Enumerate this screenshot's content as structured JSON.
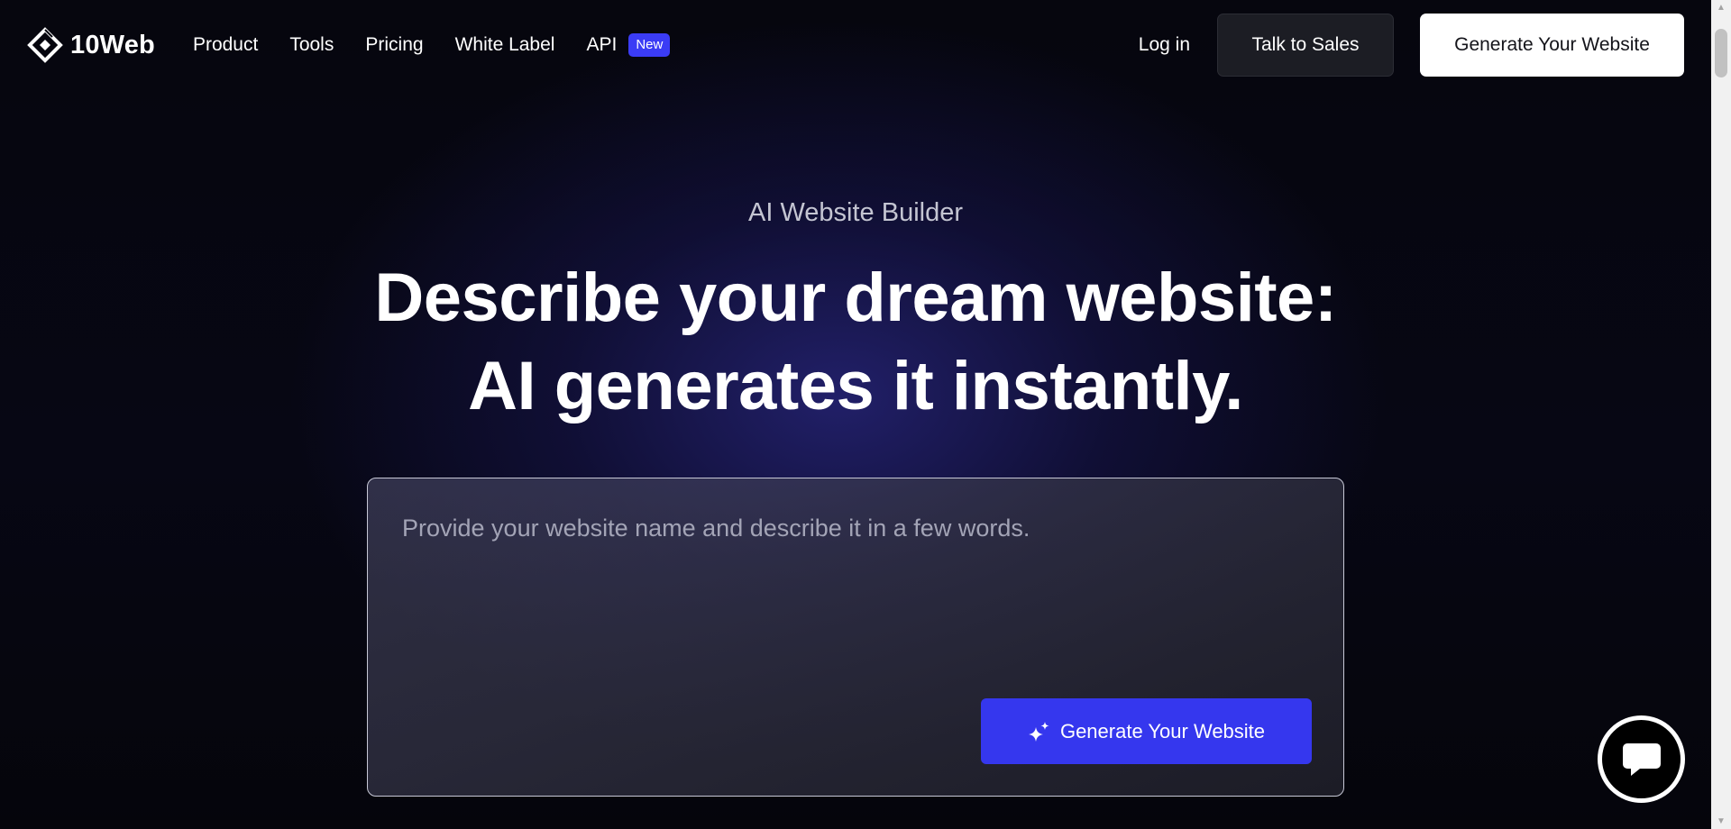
{
  "brand": {
    "name": "10Web"
  },
  "nav": {
    "links": [
      "Product",
      "Tools",
      "Pricing",
      "White Label"
    ],
    "api_label": "API",
    "api_badge": "New",
    "login": "Log in",
    "sales_button": "Talk to Sales",
    "generate_button": "Generate Your Website"
  },
  "hero": {
    "eyebrow": "AI Website Builder",
    "headline_line1": "Describe your dream website:",
    "headline_line2": "AI generates it instantly.",
    "prompt_placeholder": "Provide your website name and describe it in a few words.",
    "prompt_value": "",
    "generate_button": "Generate Your Website"
  },
  "icons": {
    "logo": "diamond-logo-icon",
    "generate": "sparkle-icon",
    "chat": "chat-bubble-icon"
  },
  "colors": {
    "accent": "#3537ee",
    "badge": "#3b3cf5",
    "nav_dark_button": "#1c1d24",
    "background": "#06060e"
  }
}
